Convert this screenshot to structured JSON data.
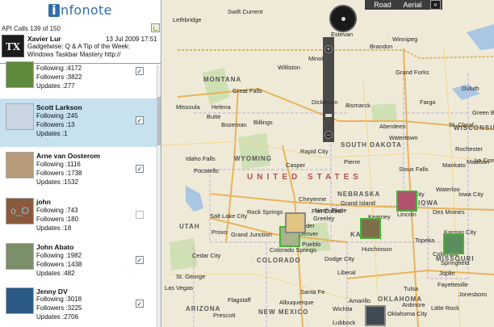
{
  "app": {
    "logo_badge": "i",
    "logo_text": "nfonote"
  },
  "api_calls": "API Calls 139 of 150",
  "latest": {
    "avatar_text": "TX",
    "name": "Xavier Lur",
    "time": "13 Jul 2009 17:51",
    "text": "Gadgetwise: Q & A Tip of the Week:\nWindows Taskbar Mastery http://"
  },
  "users": [
    {
      "name": "",
      "following": "Following :4172",
      "followers": "Followers :3822",
      "updates": "Updates :277",
      "checked": true,
      "avatar_color": "#5d8a3c"
    },
    {
      "name": "Scott Larkson",
      "following": "Following :245",
      "followers": "Followers :13",
      "updates": "Updates :1",
      "checked": true,
      "avatar_color": "#c9d6e2"
    },
    {
      "name": "Arne van Oosterom",
      "following": "Following :1116",
      "followers": "Followers :1738",
      "updates": "Updates :1532",
      "checked": true,
      "avatar_color": "#b79a7a"
    },
    {
      "name": "john",
      "following": "Following :743",
      "followers": "Followers :180",
      "updates": "Updates :18",
      "checked": false,
      "avatar_color": "#8a5a3c"
    },
    {
      "name": "John Abato",
      "following": "Following :1982",
      "followers": "Followers :1438",
      "updates": "Updates :482",
      "checked": true,
      "avatar_color": "#7c8f6b"
    },
    {
      "name": "Jenny DV",
      "following": "Following :3018",
      "followers": "Followers :3225",
      "updates": "Updates :2706",
      "checked": true,
      "avatar_color": "#2b5a86"
    }
  ],
  "john_avatar_text": "o_O",
  "check_glyph": "✓",
  "map": {
    "road_label": "Road",
    "aerial_label": "Aerial",
    "collapse_label": "«",
    "zoom_in": "+",
    "zoom_out": "−",
    "country": "UNITED STATES",
    "states": [
      "MONTANA",
      "WYOMING",
      "NEBRASKA",
      "IOWA",
      "KANSAS",
      "COLORADO",
      "UTAH",
      "ARIZONA",
      "NEW MEXICO",
      "OKLAHOMA",
      "SOUTH DAKOTA",
      "MISSOURI"
    ],
    "cities": [
      "Lethbridge",
      "Swift Current",
      "Estevan",
      "Brandon",
      "Winnipeg",
      "Minot",
      "Grand Forks",
      "Williston",
      "Great Falls",
      "Helena",
      "Missoula",
      "Butte",
      "Bozeman",
      "Billings",
      "Bismarck",
      "Fargo",
      "Duluth",
      "Dickinson",
      "Aberdeen",
      "St. Cloud",
      "Watertown",
      "Idaho Falls",
      "Pocatello",
      "Rapid City",
      "Pierre",
      "Sioux Falls",
      "Casper",
      "Mankato",
      "Rochester",
      "La Crosse",
      "Rock Springs",
      "Cheyenne",
      "Grand Island",
      "Sioux City",
      "Lincoln",
      "Des Moines",
      "Salt Lake City",
      "Provo",
      "Fort Collins",
      "Greeley",
      "Denver",
      "Boulder",
      "Colorado Springs",
      "Pueblo",
      "Hutchinson",
      "Topeka",
      "Kansas City",
      "Springfield",
      "Columbia",
      "Grand Junction",
      "Cedar City",
      "St. George",
      "Flagstaff",
      "Las Vegas",
      "Prescott",
      "Santa Fe",
      "Albuquerque",
      "Amarillo",
      "Wichita",
      "Tulsa",
      "Oklahoma City",
      "Lubbock",
      "Ardmore",
      "Little Rock",
      "Jonesboro",
      "Fayetteville",
      "Dodge City",
      "Liberal",
      "Kearney",
      "North Platte",
      "Iowa City",
      "Waterloo",
      "WISCONSIN",
      "Green Bay",
      "Madison",
      "Joplin"
    ]
  }
}
